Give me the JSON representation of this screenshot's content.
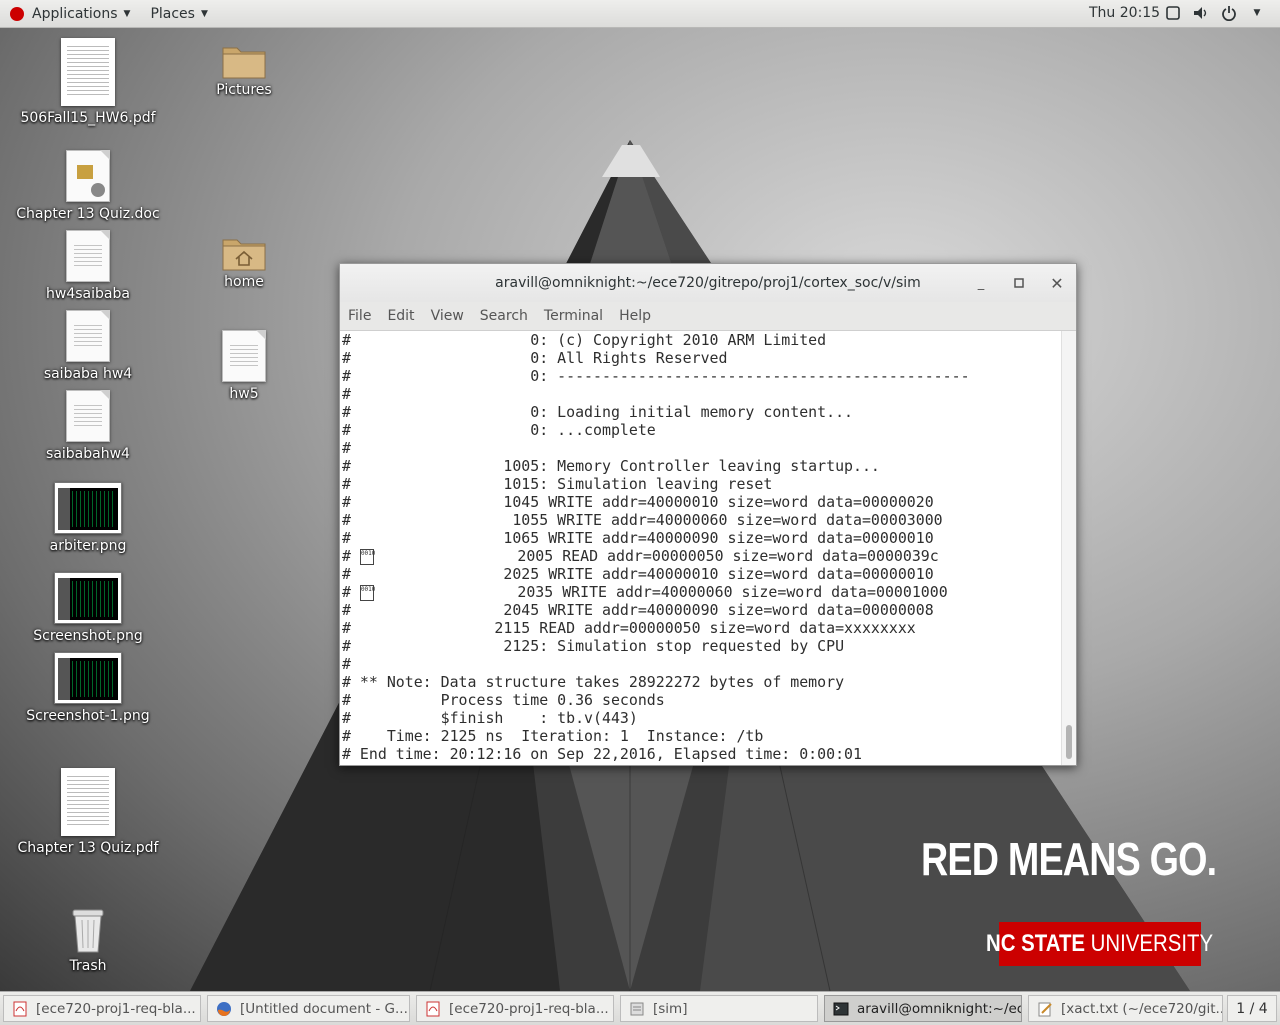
{
  "topbar": {
    "applications": "Applications",
    "places": "Places",
    "clock": "Thu 20:15"
  },
  "desktop": {
    "icons": [
      {
        "label": "506Fall15_HW6.pdf"
      },
      {
        "label": "Pictures"
      },
      {
        "label": "Chapter 13 Quiz.doc"
      },
      {
        "label": "hw4saibaba"
      },
      {
        "label": "home"
      },
      {
        "label": "saibaba hw4"
      },
      {
        "label": "hw5"
      },
      {
        "label": "saibabahw4"
      },
      {
        "label": "arbiter.png"
      },
      {
        "label": "Screenshot.png"
      },
      {
        "label": "Screenshot-1.png"
      },
      {
        "label": "Chapter 13 Quiz.pdf"
      },
      {
        "label": "Trash"
      }
    ]
  },
  "terminal": {
    "title": "aravill@omniknight:~/ece720/gitrepo/proj1/cortex_soc/v/sim",
    "menu": [
      "File",
      "Edit",
      "View",
      "Search",
      "Terminal",
      "Help"
    ],
    "lines": [
      "#                    0: (c) Copyright 2010 ARM Limited",
      "#                    0: All Rights Reserved",
      "#                    0: ----------------------------------------------",
      "#",
      "#                    0: Loading initial memory content...",
      "#                    0: ...complete",
      "#",
      "#                 1005: Memory Controller leaving startup...",
      "#                 1015: Simulation leaving reset",
      "#                 1045 WRITE addr=40000010 size=word data=00000020",
      "#                  1055 WRITE addr=40000060 size=word data=00003000",
      "#                 1065 WRITE addr=40000090 size=word data=00000010",
      "#                  2005 READ addr=00000050 size=word data=0000039c",
      "#                 2025 WRITE addr=40000010 size=word data=00000010",
      "#                  2035 WRITE addr=40000060 size=word data=00001000",
      "#                 2045 WRITE addr=40000090 size=word data=00000008",
      "#                2115 READ addr=00000050 size=word data=xxxxxxxx",
      "#                 2125: Simulation stop requested by CPU",
      "#",
      "# ** Note: Data structure takes 28922272 bytes of memory",
      "#          Process time 0.36 seconds",
      "#          $finish    : tb.v(443)",
      "#    Time: 2125 ns  Iteration: 1  Instance: /tb",
      "# End time: 20:12:16 on Sep 22,2016, Elapsed time: 0:00:01"
    ],
    "glyph": "0010"
  },
  "branding": {
    "slogan": "RED MEANS GO.",
    "university_bold": "NC STATE",
    "university_rest": " UNIVERSITY"
  },
  "taskbar": {
    "items": [
      {
        "label": "[ece720-proj1-req-bla...",
        "icon": "pdf-icon"
      },
      {
        "label": "[Untitled document - G...",
        "icon": "firefox-icon"
      },
      {
        "label": "[ece720-proj1-req-bla...",
        "icon": "pdf-icon"
      },
      {
        "label": "[sim]",
        "icon": "file-manager-icon"
      },
      {
        "label": "aravill@omniknight:~/ec...",
        "icon": "terminal-icon"
      },
      {
        "label": "[xact.txt (~/ece720/git...",
        "icon": "text-editor-icon"
      }
    ],
    "workspace": "1 / 4"
  }
}
